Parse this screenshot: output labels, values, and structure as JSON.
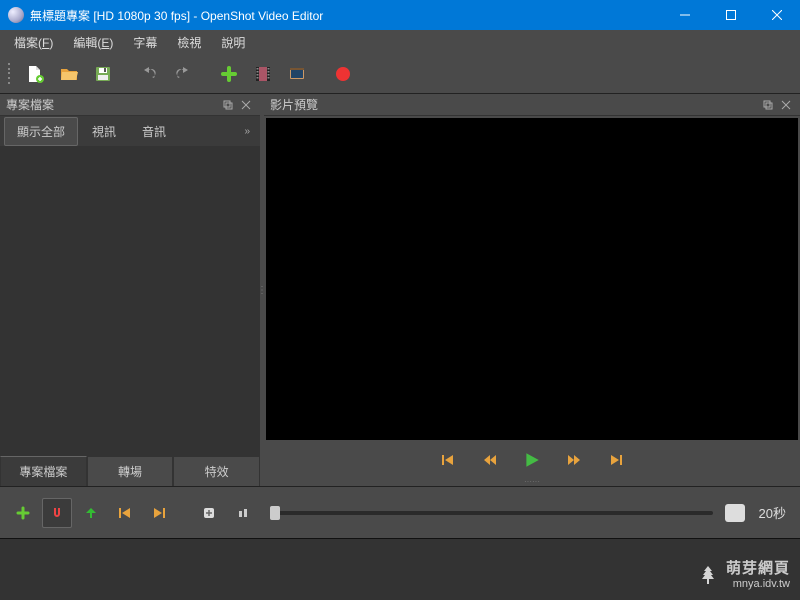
{
  "titlebar": {
    "title": "無標題專案 [HD 1080p 30 fps] - OpenShot Video Editor"
  },
  "menu": {
    "file": {
      "label": "檔案",
      "accel": "F"
    },
    "edit": {
      "label": "編輯",
      "accel": "E"
    },
    "subtitle": {
      "label": "字幕"
    },
    "view": {
      "label": "檢視"
    },
    "help": {
      "label": "說明"
    }
  },
  "panels": {
    "files": {
      "title": "專案檔案"
    },
    "preview": {
      "title": "影片預覽"
    }
  },
  "file_tabs": {
    "all": "顯示全部",
    "video": "視訊",
    "audio": "音訊"
  },
  "bottom_tabs": {
    "files": "專案檔案",
    "transitions": "轉場",
    "effects": "特效"
  },
  "zoom": {
    "value": "20",
    "unit": "秒"
  },
  "watermark": {
    "name": "萌芽網頁",
    "url": "mnya.idv.tw"
  }
}
